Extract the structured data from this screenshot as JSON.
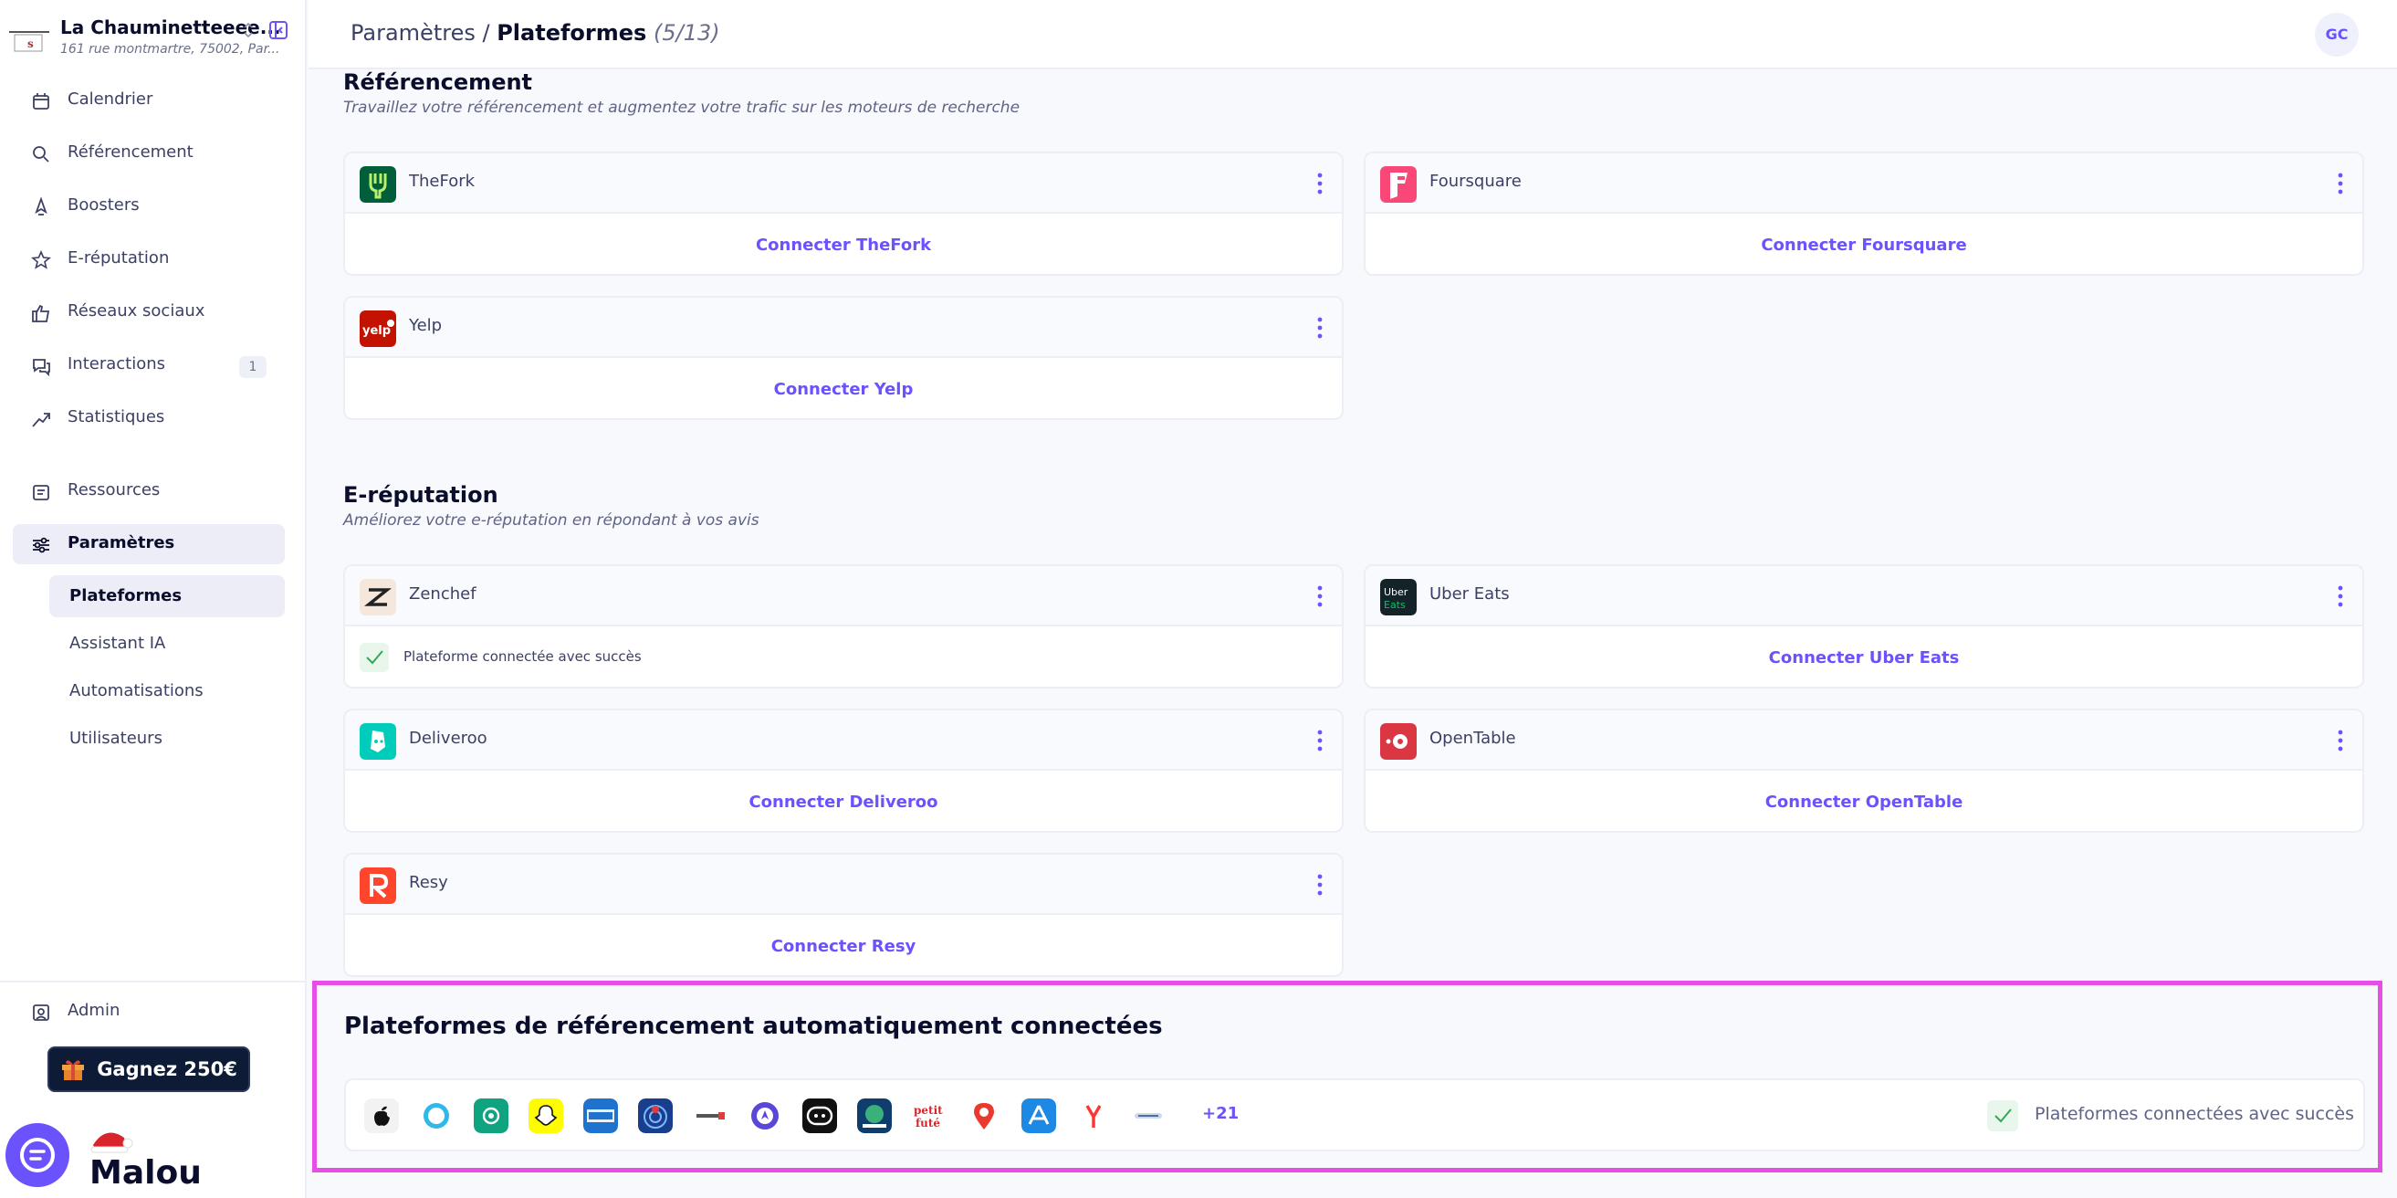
{
  "restaurant": {
    "name": "La Chauminetteeee...",
    "address": "161 rue montmartre, 75002, Par..."
  },
  "sidebar": {
    "items": [
      {
        "label": "Calendrier",
        "icon": "calendar-icon"
      },
      {
        "label": "Référencement",
        "icon": "search-icon"
      },
      {
        "label": "Boosters",
        "icon": "rocket-icon"
      },
      {
        "label": "E-réputation",
        "icon": "star-icon"
      },
      {
        "label": "Réseaux sociaux",
        "icon": "thumbs-up-icon"
      },
      {
        "label": "Interactions",
        "icon": "chat-bubbles-icon",
        "badge": "1"
      },
      {
        "label": "Statistiques",
        "icon": "trend-up-icon"
      },
      {
        "label": "Ressources",
        "icon": "folder-icon"
      },
      {
        "label": "Paramètres",
        "icon": "sliders-icon"
      }
    ],
    "sub_items": [
      {
        "label": "Plateformes"
      },
      {
        "label": "Assistant IA"
      },
      {
        "label": "Automatisations"
      },
      {
        "label": "Utilisateurs"
      }
    ],
    "admin_label": "Admin",
    "gift_label": "Gagnez 250€",
    "brand": "Malou"
  },
  "header": {
    "crumb_parent": "Paramètres",
    "separator": "/",
    "crumb_current": "Plateformes",
    "count": "(5/13)",
    "avatar_initials": "GC"
  },
  "sections": {
    "seo": {
      "title": "Référencement",
      "subtitle": "Travaillez votre référencement et augmentez votre trafic sur les moteurs de recherche",
      "cards": [
        {
          "name": "TheFork",
          "action": "Connecter TheFork"
        },
        {
          "name": "Foursquare",
          "action": "Connecter Foursquare"
        },
        {
          "name": "Yelp",
          "action": "Connecter Yelp"
        }
      ]
    },
    "ereputation": {
      "title": "E-réputation",
      "subtitle": "Améliorez votre e-réputation en répondant à vos avis",
      "cards": [
        {
          "name": "Zenchef",
          "status": "Plateforme connectée avec succès"
        },
        {
          "name": "Uber Eats",
          "action": "Connecter Uber Eats"
        },
        {
          "name": "Deliveroo",
          "action": "Connecter Deliveroo"
        },
        {
          "name": "OpenTable",
          "action": "Connecter OpenTable"
        },
        {
          "name": "Resy",
          "action": "Connecter Resy"
        }
      ]
    },
    "auto": {
      "title": "Plateformes de référencement automatiquement connectées",
      "more": "+21",
      "status": "Plateformes connectées avec succès"
    }
  },
  "colors": {
    "accent": "#6a52fd",
    "highlight_border": "#e64ee6",
    "success": "#34a853"
  }
}
